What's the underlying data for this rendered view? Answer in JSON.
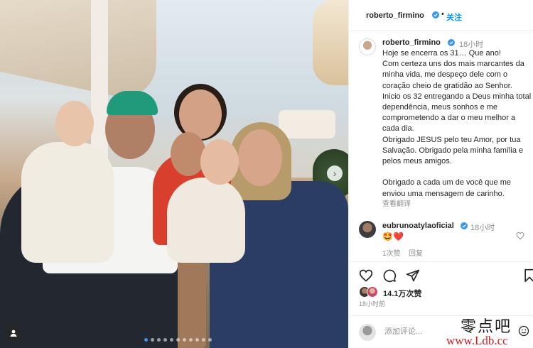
{
  "post": {
    "dots_total": 11,
    "dot_active_index": 0
  },
  "header": {
    "username": "roberto_firmino",
    "separator": "•",
    "follow_label": "关注"
  },
  "caption": {
    "username": "roberto_firmino",
    "time": "18小时",
    "text": "Hoje se encerra os 31… Que ano!\nCom certeza uns dos mais marcantes da minha vida, me despeço dele com o coração cheio de gratidão ao Senhor. Inicio os 32 entregando a Deus minha total dependência, meus sonhos e me comprometendo a dar o meu melhor a cada dia.\nObrigado JESUS pelo teu Amor, por tua Salvação. Obrigado pela minha família e pelos meus amigos.\n\nObrigado a cada um de você que me enviou uma mensagem de carinho.",
    "translate_label": "查看翻译"
  },
  "comment": {
    "username": "eubrunoatylaoficial",
    "time": "18小时",
    "text": "🤩❤️",
    "likes": "1次赞",
    "reply_label": "回复"
  },
  "actions": {
    "likes_count": "14.1万次赞",
    "post_time": "18小时前"
  },
  "add_comment": {
    "placeholder": "添加评论..."
  },
  "watermark": {
    "chinese": "零点吧",
    "url": "www.Ldb.cc"
  },
  "colors": {
    "accent": "#0095f6",
    "verified": "#3897f0",
    "text": "#262626",
    "muted": "#8e8e8e",
    "watermark_red": "#d81e1e"
  }
}
